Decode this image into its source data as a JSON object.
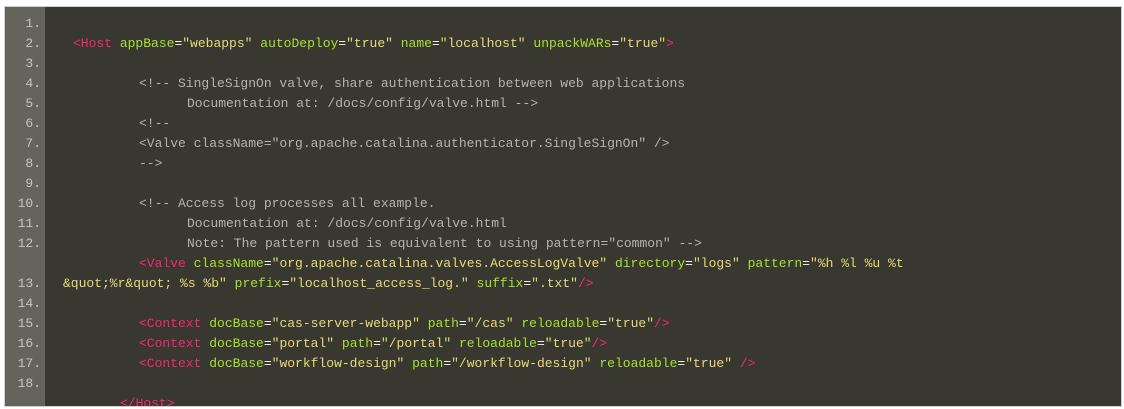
{
  "code": {
    "line_numbers": [
      "1.",
      "2.",
      "3.",
      "4.",
      "5.",
      "6.",
      "7.",
      "8.",
      "9.",
      "10.",
      "11.",
      "12.",
      "13.",
      "14.",
      "15.",
      "16.",
      "17.",
      "18."
    ],
    "l1": {
      "open": "<Host",
      "a1": "appBase",
      "v1": "\"webapps\"",
      "a2": "autoDeploy",
      "v2": "\"true\"",
      "a3": "name",
      "v3": "\"localhost\"",
      "a4": "unpackWARs",
      "v4": "\"true\"",
      "close": ">"
    },
    "l3": "<!-- SingleSignOn valve, share authentication between web applications",
    "l4": "Documentation at: /docs/config/valve.html -->",
    "l5": "<!--",
    "l6": "<Valve className=\"org.apache.catalina.authenticator.SingleSignOn\" />",
    "l7": "-->",
    "l9": "<!-- Access log processes all example.",
    "l10": "Documentation at: /docs/config/valve.html",
    "l11": "Note: The pattern used is equivalent to using pattern=\"common\" -->",
    "l12": {
      "open": "<Valve",
      "a1": "className",
      "v1": "\"org.apache.catalina.valves.AccessLogValve\"",
      "a2": "directory",
      "v2": "\"logs\"",
      "a3": "pattern",
      "v3": "\"%h %l %u %t",
      "v3b": "&quot;%r&quot; %s %b\"",
      "a4": "prefix",
      "v4": "\"localhost_access_log.\"",
      "a5": "suffix",
      "v5": "\".txt\"",
      "close": "/>"
    },
    "l14": {
      "open": "<Context",
      "a1": "docBase",
      "v1": "\"cas-server-webapp\"",
      "a2": "path",
      "v2": "\"/cas\"",
      "a3": "reloadable",
      "v3": "\"true\"",
      "close": "/>"
    },
    "l15": {
      "open": "<Context",
      "a1": "docBase",
      "v1": "\"portal\"",
      "a2": "path",
      "v2": "\"/portal\"",
      "a3": "reloadable",
      "v3": "\"true\"",
      "close": "/>"
    },
    "l16": {
      "open": "<Context",
      "a1": "docBase",
      "v1": "\"workflow-design\"",
      "a2": "path",
      "v2": "\"/workflow-design\"",
      "a3": "reloadable",
      "v3": "\"true\"",
      "close": "/>"
    },
    "l18": "</Host>"
  },
  "colors": {
    "background": "#383830",
    "gutter": "#64645c",
    "tag": "#f92672",
    "attribute": "#a6e22e",
    "string": "#e6db74",
    "comment": "#b4b4ac"
  }
}
